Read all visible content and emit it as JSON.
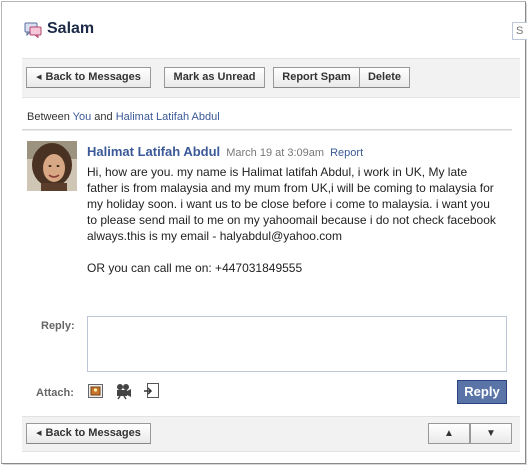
{
  "page": {
    "title": "Salam"
  },
  "search": {
    "placeholder": "S"
  },
  "toolbar": {
    "back_label": "Back to Messages",
    "mark_unread_label": "Mark as Unread",
    "report_spam_label": "Report Spam",
    "delete_label": "Delete"
  },
  "participants": {
    "prefix": "Between",
    "you": "You",
    "and": "and",
    "other": "Halimat Latifah Abdul"
  },
  "message": {
    "author": "Halimat Latifah Abdul",
    "time": "March 19 at 3:09am",
    "report_label": "Report",
    "body_p1": "Hi, how are you. my name is Halimat latifah Abdul, i work in UK, My late father is from malaysia and my mum from UK,i will be coming to malaysia for my holiday soon. i want us to be close before i come to malaysia. i want you to please send mail to me on my yahoomail because i do not check facebook always.this is my email - halyabdul@yahoo.com",
    "body_p2": "OR you can call me on: +447031849555"
  },
  "reply": {
    "label": "Reply:",
    "value": "",
    "attach_label": "Attach:",
    "button_label": "Reply"
  },
  "bottom": {
    "back_label": "Back to Messages",
    "up_label": "▲",
    "down_label": "▼"
  },
  "icons": {
    "messages": "messages-icon",
    "photo": "photo-attach-icon",
    "video": "video-attach-icon",
    "link": "link-attach-icon"
  },
  "colors": {
    "link": "#3b5998",
    "title": "#1c2a47",
    "reply_button": "#5b74a8"
  }
}
